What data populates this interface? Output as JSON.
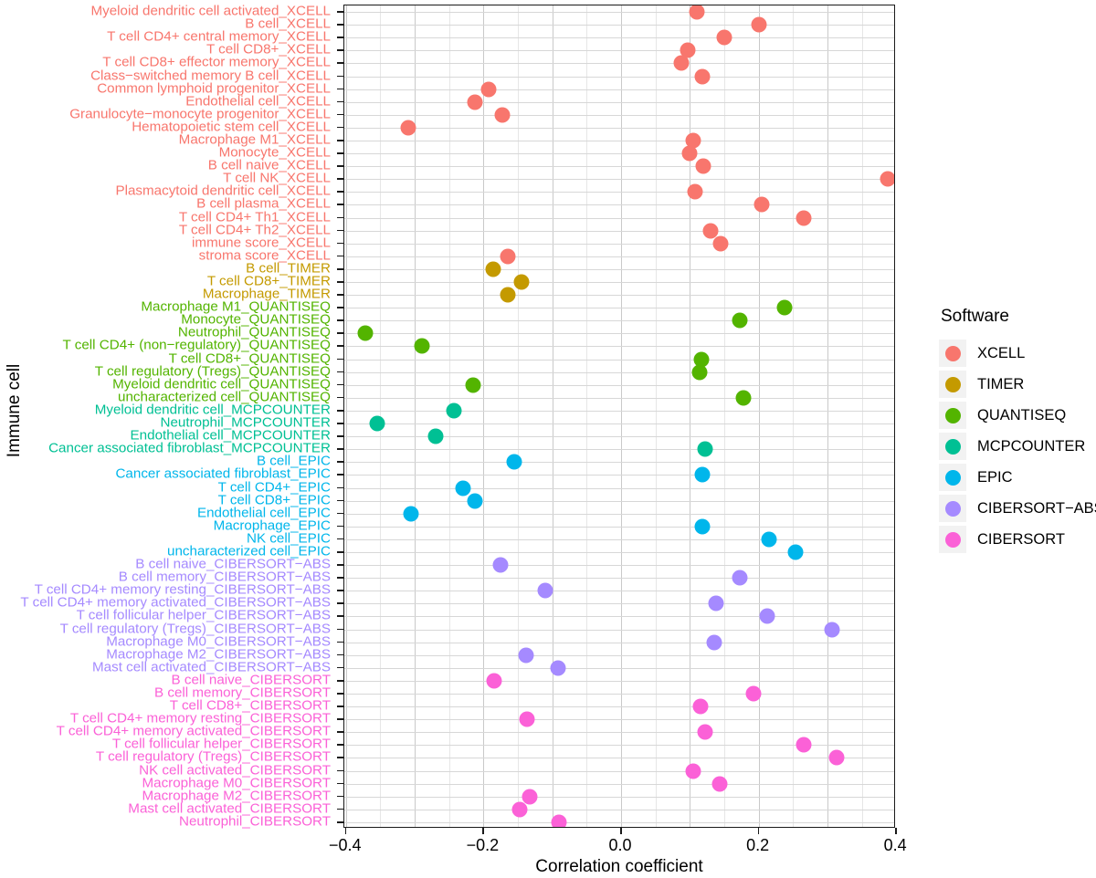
{
  "axes": {
    "y_title": "Immune cell",
    "x_title": "Correlation coefficient",
    "x_ticks": [
      "-0.4",
      "-0.2",
      "0.0",
      "0.2",
      "0.4"
    ]
  },
  "legend": {
    "title": "Software",
    "items": [
      {
        "label": "XCELL",
        "color": "#F8766D"
      },
      {
        "label": "TIMER",
        "color": "#C49A00"
      },
      {
        "label": "QUANTISEQ",
        "color": "#53B400"
      },
      {
        "label": "MCPCOUNTER",
        "color": "#00C094"
      },
      {
        "label": "EPIC",
        "color": "#00B6EB"
      },
      {
        "label": "CIBERSORT-ABS",
        "color": "#A58AFF"
      },
      {
        "label": "CIBERSORT",
        "color": "#FB61D7"
      }
    ]
  },
  "chart_data": {
    "type": "scatter",
    "title": "",
    "xlabel": "Correlation coefficient",
    "ylabel": "Immune cell",
    "xlim": [
      -0.45,
      0.43
    ],
    "x_ticks": [
      -0.4,
      -0.2,
      0.0,
      0.2,
      0.4
    ],
    "grid": true,
    "legend_position": "right",
    "legend_title": "Software",
    "series": [
      {
        "name": "XCELL",
        "color": "#F8766D",
        "points": [
          {
            "category": "Myeloid dendritic cell activated_XCELL",
            "value": 0.11
          },
          {
            "category": "B cell_XCELL",
            "value": 0.2
          },
          {
            "category": "T cell CD4+ central memory_XCELL",
            "value": 0.15
          },
          {
            "category": "T cell CD8+_XCELL",
            "value": 0.097
          },
          {
            "category": "T cell CD8+ effector memory_XCELL",
            "value": 0.087
          },
          {
            "category": "Class-switched memory B cell_XCELL",
            "value": 0.118
          },
          {
            "category": "Common lymphoid progenitor_XCELL",
            "value": -0.193
          },
          {
            "category": "Endothelial cell_XCELL",
            "value": -0.212
          },
          {
            "category": "Granulocyte-monocyte progenitor_XCELL",
            "value": -0.173
          },
          {
            "category": "Hematopoietic stem cell_XCELL",
            "value": -0.309
          },
          {
            "category": "Macrophage M1_XCELL",
            "value": 0.105
          },
          {
            "category": "Monocyte_XCELL",
            "value": 0.1
          },
          {
            "category": "B cell naive_XCELL",
            "value": 0.119
          },
          {
            "category": "T cell NK_XCELL",
            "value": 0.388
          },
          {
            "category": "Plasmacytoid dendritic cell_XCELL",
            "value": 0.108
          },
          {
            "category": "B cell plasma_XCELL",
            "value": 0.205
          },
          {
            "category": "T cell CD4+ Th1_XCELL",
            "value": 0.265
          },
          {
            "category": "T cell CD4+ Th2_XCELL",
            "value": 0.13
          },
          {
            "category": "immune score_XCELL",
            "value": 0.145
          },
          {
            "category": "stroma score_XCELL",
            "value": -0.165
          }
        ]
      },
      {
        "name": "TIMER",
        "color": "#C49A00",
        "points": [
          {
            "category": "B cell_TIMER",
            "value": -0.186
          },
          {
            "category": "T cell CD8+_TIMER",
            "value": -0.145
          },
          {
            "category": "Macrophage_TIMER",
            "value": -0.165
          }
        ]
      },
      {
        "name": "QUANTISEQ",
        "color": "#53B400",
        "points": [
          {
            "category": "Macrophage M1_QUANTISEQ",
            "value": 0.238
          },
          {
            "category": "Monocyte_QUANTISEQ",
            "value": 0.172
          },
          {
            "category": "Neutrophil_QUANTISEQ",
            "value": -0.372
          },
          {
            "category": "T cell CD4+ (non-regulatory)_QUANTISEQ",
            "value": -0.29
          },
          {
            "category": "T cell CD8+_QUANTISEQ",
            "value": 0.117
          },
          {
            "category": "T cell regulatory (Tregs)_QUANTISEQ",
            "value": 0.114
          },
          {
            "category": "Myeloid dendritic cell_QUANTISEQ",
            "value": -0.215
          },
          {
            "category": "uncharacterized cell_QUANTISEQ",
            "value": 0.178
          }
        ]
      },
      {
        "name": "MCPCOUNTER",
        "color": "#00C094",
        "points": [
          {
            "category": "Myeloid dendritic cell_MCPCOUNTER",
            "value": -0.243
          },
          {
            "category": "Neutrophil_MCPCOUNTER",
            "value": -0.355
          },
          {
            "category": "Endothelial cell_MCPCOUNTER",
            "value": -0.27
          },
          {
            "category": "Cancer associated fibroblast_MCPCOUNTER",
            "value": 0.122
          }
        ]
      },
      {
        "name": "EPIC",
        "color": "#00B6EB",
        "points": [
          {
            "category": "B cell_EPIC",
            "value": -0.155
          },
          {
            "category": "Cancer associated fibroblast_EPIC",
            "value": 0.118
          },
          {
            "category": "T cell CD4+_EPIC",
            "value": -0.23
          },
          {
            "category": "T cell CD8+_EPIC",
            "value": -0.213
          },
          {
            "category": "Endothelial cell_EPIC",
            "value": -0.305
          },
          {
            "category": "Macrophage_EPIC",
            "value": 0.118
          },
          {
            "category": "NK cell_EPIC",
            "value": 0.215
          },
          {
            "category": "uncharacterized cell_EPIC",
            "value": 0.253
          }
        ]
      },
      {
        "name": "CIBERSORT-ABS",
        "color": "#A58AFF",
        "points": [
          {
            "category": "B cell naive_CIBERSORT-ABS",
            "value": -0.175
          },
          {
            "category": "B cell memory_CIBERSORT-ABS",
            "value": 0.172
          },
          {
            "category": "T cell CD4+ memory resting_CIBERSORT-ABS",
            "value": -0.11
          },
          {
            "category": "T cell CD4+ memory activated_CIBERSORT-ABS",
            "value": 0.138
          },
          {
            "category": "T cell follicular helper_CIBERSORT-ABS",
            "value": 0.212
          },
          {
            "category": "T cell regulatory (Tregs)_CIBERSORT-ABS",
            "value": 0.307
          },
          {
            "category": "Macrophage M0_CIBERSORT-ABS",
            "value": 0.135
          },
          {
            "category": "Macrophage M2_CIBERSORT-ABS",
            "value": -0.138
          },
          {
            "category": "Mast cell activated_CIBERSORT-ABS",
            "value": -0.092
          }
        ]
      },
      {
        "name": "CIBERSORT",
        "color": "#FB61D7",
        "points": [
          {
            "category": "B cell naive_CIBERSORT",
            "value": -0.185
          },
          {
            "category": "B cell memory_CIBERSORT",
            "value": 0.192
          },
          {
            "category": "T cell CD8+_CIBERSORT",
            "value": 0.115
          },
          {
            "category": "T cell CD4+ memory resting_CIBERSORT",
            "value": -0.137
          },
          {
            "category": "T cell CD4+ memory activated_CIBERSORT",
            "value": 0.122
          },
          {
            "category": "T cell follicular helper_CIBERSORT",
            "value": 0.265
          },
          {
            "category": "T cell regulatory (Tregs)_CIBERSORT",
            "value": 0.313
          },
          {
            "category": "NK cell activated_CIBERSORT",
            "value": 0.105
          },
          {
            "category": "Macrophage M0_CIBERSORT",
            "value": 0.143
          },
          {
            "category": "Macrophage M2_CIBERSORT",
            "value": -0.133
          },
          {
            "category": "Mast cell activated_CIBERSORT",
            "value": -0.147
          },
          {
            "category": "Neutrophil_CIBERSORT",
            "value": -0.09
          }
        ]
      }
    ],
    "categories": [
      "Myeloid dendritic cell activated_XCELL",
      "B cell_XCELL",
      "T cell CD4+ central memory_XCELL",
      "T cell CD8+_XCELL",
      "T cell CD8+ effector memory_XCELL",
      "Class-switched memory B cell_XCELL",
      "Common lymphoid progenitor_XCELL",
      "Endothelial cell_XCELL",
      "Granulocyte-monocyte progenitor_XCELL",
      "Hematopoietic stem cell_XCELL",
      "Macrophage M1_XCELL",
      "Monocyte_XCELL",
      "B cell naive_XCELL",
      "T cell NK_XCELL",
      "Plasmacytoid dendritic cell_XCELL",
      "B cell plasma_XCELL",
      "T cell CD4+ Th1_XCELL",
      "T cell CD4+ Th2_XCELL",
      "immune score_XCELL",
      "stroma score_XCELL",
      "B cell_TIMER",
      "T cell CD8+_TIMER",
      "Macrophage_TIMER",
      "Macrophage M1_QUANTISEQ",
      "Monocyte_QUANTISEQ",
      "Neutrophil_QUANTISEQ",
      "T cell CD4+ (non-regulatory)_QUANTISEQ",
      "T cell CD8+_QUANTISEQ",
      "T cell regulatory (Tregs)_QUANTISEQ",
      "Myeloid dendritic cell_QUANTISEQ",
      "uncharacterized cell_QUANTISEQ",
      "Myeloid dendritic cell_MCPCOUNTER",
      "Neutrophil_MCPCOUNTER",
      "Endothelial cell_MCPCOUNTER",
      "Cancer associated fibroblast_MCPCOUNTER",
      "B cell_EPIC",
      "Cancer associated fibroblast_EPIC",
      "T cell CD4+_EPIC",
      "T cell CD8+_EPIC",
      "Endothelial cell_EPIC",
      "Macrophage_EPIC",
      "NK cell_EPIC",
      "uncharacterized cell_EPIC",
      "B cell naive_CIBERSORT-ABS",
      "B cell memory_CIBERSORT-ABS",
      "T cell CD4+ memory resting_CIBERSORT-ABS",
      "T cell CD4+ memory activated_CIBERSORT-ABS",
      "T cell follicular helper_CIBERSORT-ABS",
      "T cell regulatory (Tregs)_CIBERSORT-ABS",
      "Macrophage M0_CIBERSORT-ABS",
      "Macrophage M2_CIBERSORT-ABS",
      "Mast cell activated_CIBERSORT-ABS",
      "B cell naive_CIBERSORT",
      "B cell memory_CIBERSORT",
      "T cell CD8+_CIBERSORT",
      "T cell CD4+ memory resting_CIBERSORT",
      "T cell CD4+ memory activated_CIBERSORT",
      "T cell follicular helper_CIBERSORT",
      "T cell regulatory (Tregs)_CIBERSORT",
      "NK cell activated_CIBERSORT",
      "Macrophage M0_CIBERSORT",
      "Macrophage M2_CIBERSORT",
      "Mast cell activated_CIBERSORT",
      "Neutrophil_CIBERSORT"
    ]
  }
}
